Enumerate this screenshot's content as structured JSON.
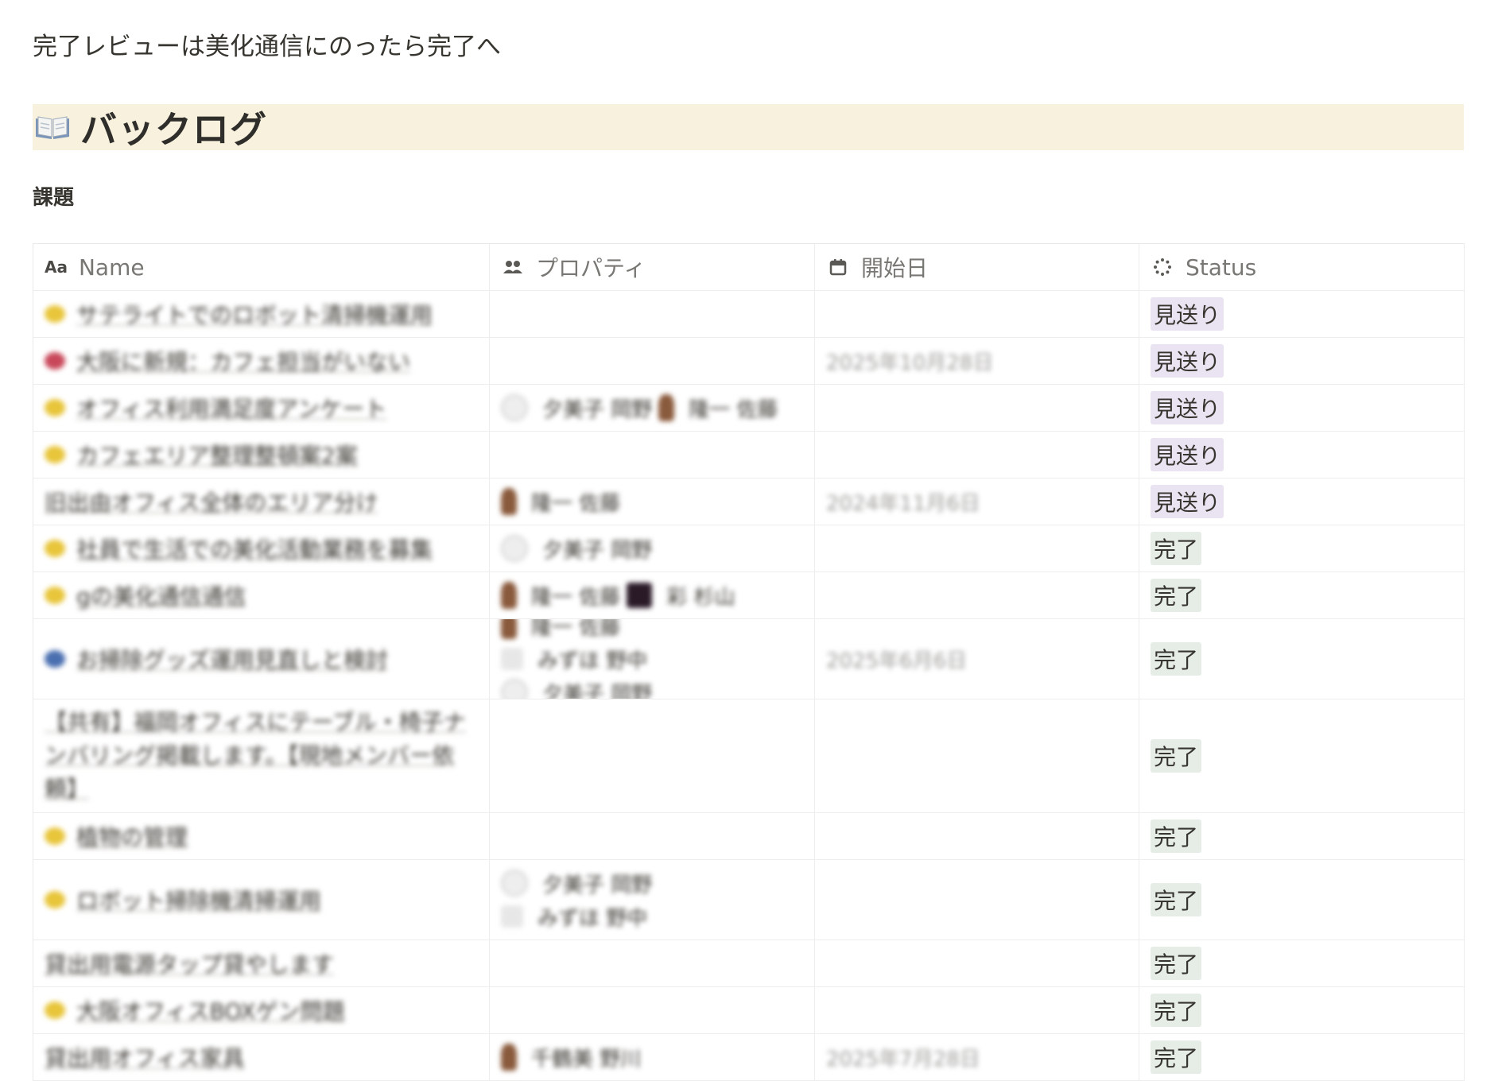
{
  "intro_text": "完了レビューは美化通信にのったら完了へ",
  "heading": {
    "icon": "open-book-icon",
    "title": "バックログ"
  },
  "section_label": "課題",
  "table": {
    "columns": [
      {
        "label": "Name",
        "icon": "text-type-icon",
        "icon_text": "Aa"
      },
      {
        "label": "プロパティ",
        "icon": "people-icon"
      },
      {
        "label": "開始日",
        "icon": "calendar-icon"
      },
      {
        "label": "Status",
        "icon": "status-spinner-icon"
      }
    ],
    "rows": [
      {
        "name": "サテライトでのロボット清掃機運用",
        "icon_color": "#e8c53a",
        "people": [],
        "date": "",
        "status": "見送り",
        "status_kind": "skip"
      },
      {
        "name": "大阪に新規：カフェ担当がいない",
        "icon_color": "#c8485a",
        "people": [],
        "date": "2025年10月28日",
        "status": "見送り",
        "status_kind": "skip"
      },
      {
        "name": "オフィス利用満足度アンケート",
        "icon_color": "#e8c53a",
        "people": [
          {
            "name": "夕美子 岡野",
            "avatar": "gray"
          },
          {
            "name": "隆一 佐藤",
            "avatar": "fig"
          }
        ],
        "people_inline": true,
        "date": "",
        "status": "見送り",
        "status_kind": "skip"
      },
      {
        "name": "カフェエリア整理整頓案2案",
        "icon_color": "#e8c53a",
        "people": [],
        "date": "",
        "status": "見送り",
        "status_kind": "skip"
      },
      {
        "name": "旧出由オフィス全体のエリア分け",
        "icon_color": "",
        "people": [
          {
            "name": "隆一 佐藤",
            "avatar": "fig"
          }
        ],
        "date": "2024年11月6日",
        "status": "見送り",
        "status_kind": "skip"
      },
      {
        "name": "社員で生活での美化活動業務を募集",
        "icon_color": "#e8c53a",
        "people": [
          {
            "name": "夕美子 岡野",
            "avatar": "gray"
          }
        ],
        "date": "",
        "status": "完了",
        "status_kind": "done"
      },
      {
        "name": "gの美化通信通信",
        "icon_color": "#e8c53a",
        "people": [
          {
            "name": "隆一 佐藤",
            "avatar": "fig"
          },
          {
            "name": "彩 杉山",
            "avatar": "dark"
          }
        ],
        "people_inline": true,
        "date": "",
        "status": "完了",
        "status_kind": "done"
      },
      {
        "name": "お掃除グッズ運用見直しと検討",
        "icon_color": "#4a6fb0",
        "people": [
          {
            "name": "隆一 佐藤",
            "avatar": "fig"
          },
          {
            "name": "みずほ 野中",
            "avatar": "sq"
          },
          {
            "name": "夕美子 岡野",
            "avatar": "gray"
          }
        ],
        "date": "2025年6月6日",
        "status": "完了",
        "status_kind": "done"
      },
      {
        "name": "【共有】福岡オフィスにテーブル・椅子ナンバリング掲載します。【現地メンバー依頼】",
        "icon_color": "",
        "people": [],
        "date": "",
        "status": "完了",
        "status_kind": "done",
        "wrap": true
      },
      {
        "name": "植物の管理",
        "icon_color": "#e8c53a",
        "people": [],
        "date": "",
        "status": "完了",
        "status_kind": "done"
      },
      {
        "name": "ロボット掃除機清掃運用",
        "icon_color": "#e8c53a",
        "people": [
          {
            "name": "夕美子 岡野",
            "avatar": "gray"
          },
          {
            "name": "みずほ 野中",
            "avatar": "sq"
          }
        ],
        "date": "",
        "status": "完了",
        "status_kind": "done"
      },
      {
        "name": "貸出用電源タップ貸やします",
        "icon_color": "",
        "people": [],
        "date": "",
        "status": "完了",
        "status_kind": "done"
      },
      {
        "name": "大阪オフィスBOXゲン問題",
        "icon_color": "#e8c53a",
        "people": [],
        "date": "",
        "status": "完了",
        "status_kind": "done"
      },
      {
        "name": "貸出用オフィス家具",
        "icon_color": "",
        "people": [
          {
            "name": "千鶴美 野川",
            "avatar": "fig"
          }
        ],
        "date": "2025年7月28日",
        "status": "完了",
        "status_kind": "done"
      }
    ]
  }
}
